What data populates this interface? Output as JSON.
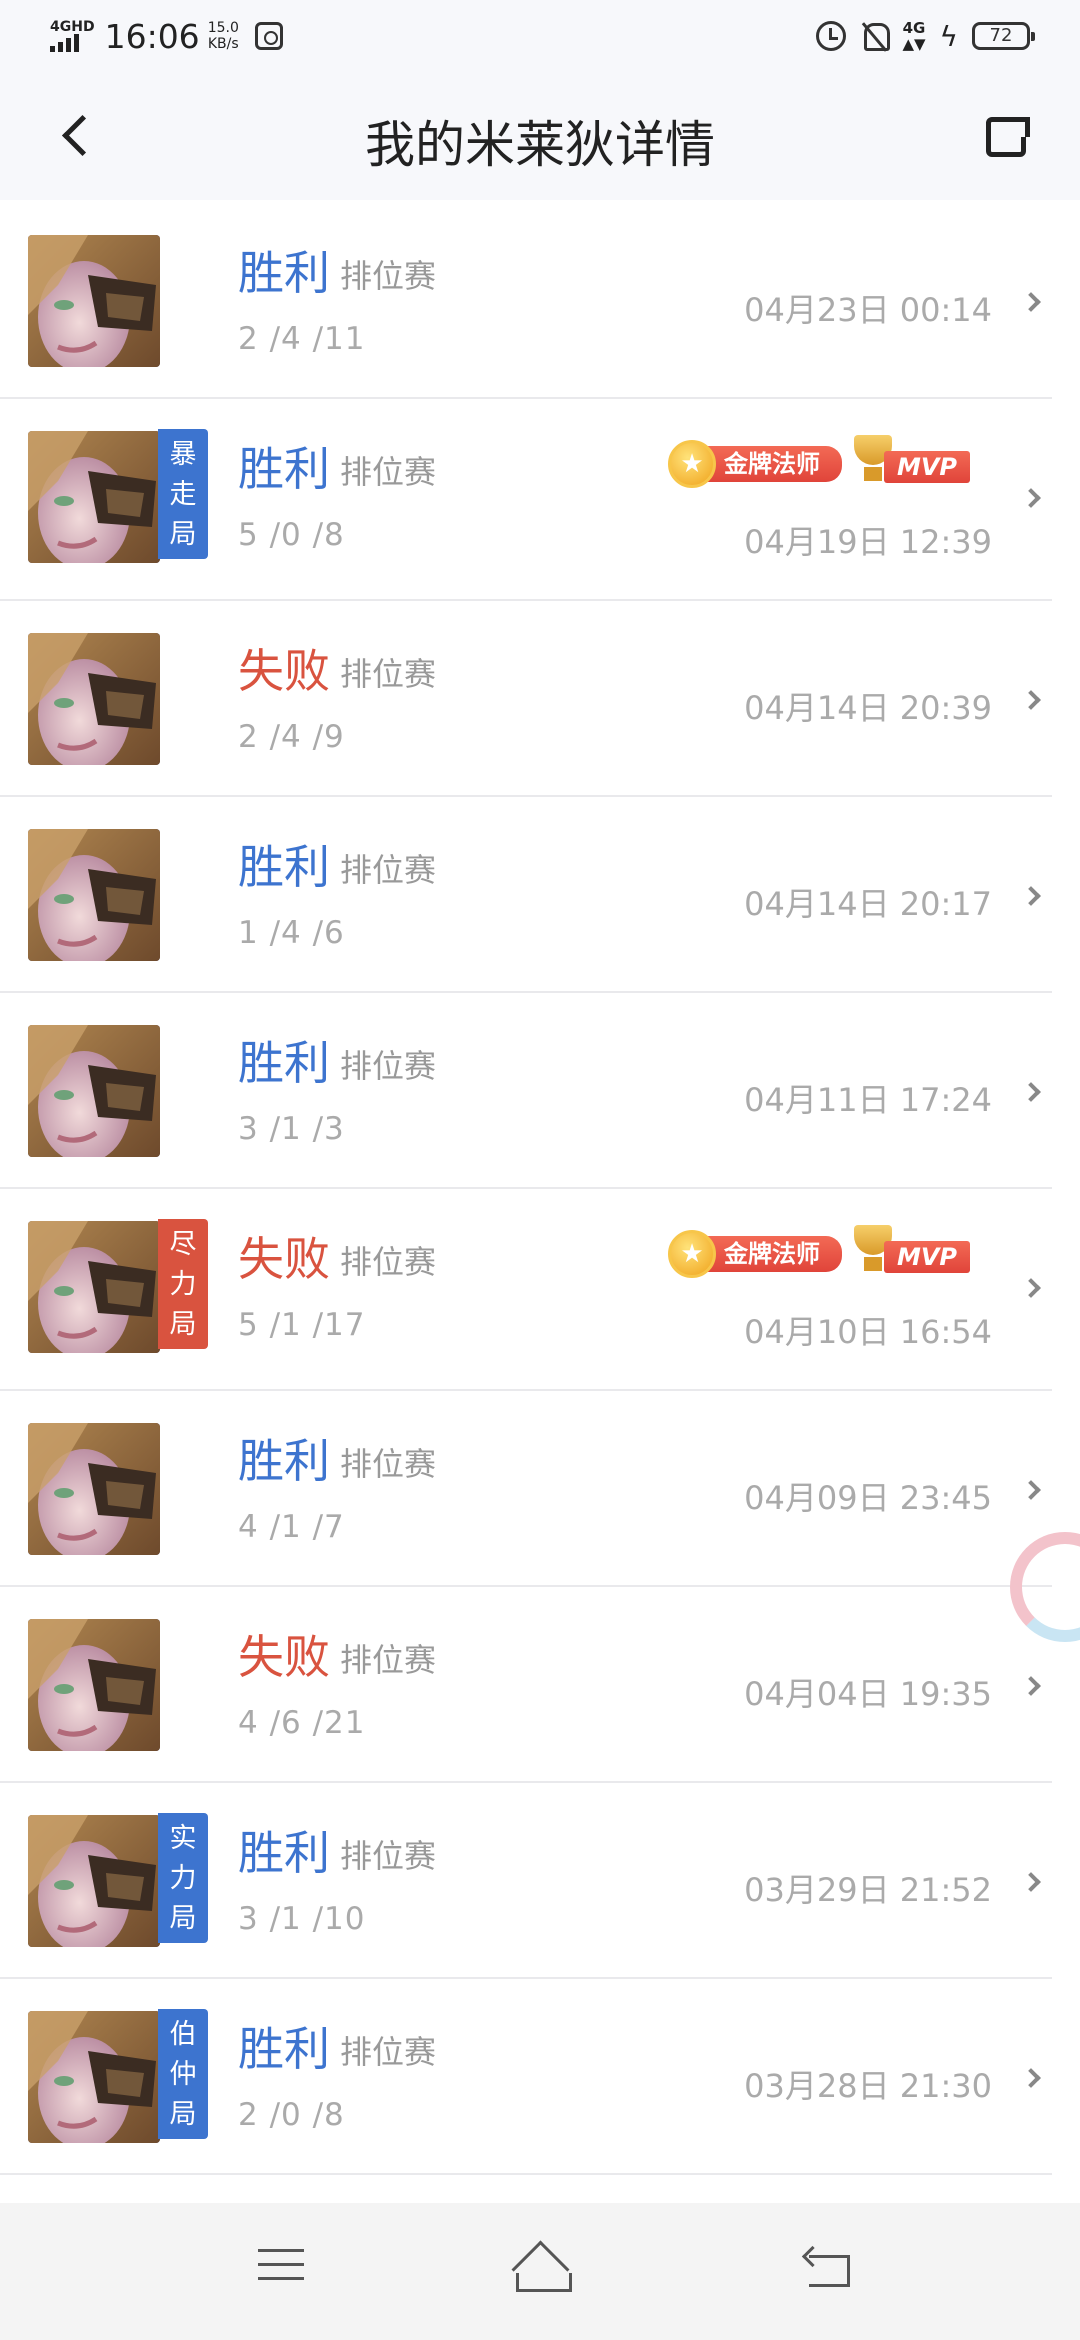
{
  "status_bar": {
    "network": "4GHD",
    "time": "16:06",
    "speed_value": "15.0",
    "speed_unit": "KB/s",
    "net_type": "4G",
    "battery": "72"
  },
  "header": {
    "title": "我的米莱狄详情"
  },
  "matches": [
    {
      "result": "胜利",
      "outcome": "win",
      "mode": "排位赛",
      "kda": "2 /4 /11",
      "datetime": "04月23日 00:14",
      "tag": "",
      "badges": false
    },
    {
      "result": "胜利",
      "outcome": "win",
      "mode": "排位赛",
      "kda": "5 /0 /8",
      "datetime": "04月19日 12:39",
      "tag": "暴走局",
      "tag_color": "blue",
      "badges": true,
      "gold_badge": "金牌法师",
      "mvp_badge": "MVP"
    },
    {
      "result": "失败",
      "outcome": "lose",
      "mode": "排位赛",
      "kda": "2 /4 /9",
      "datetime": "04月14日 20:39",
      "tag": "",
      "badges": false
    },
    {
      "result": "胜利",
      "outcome": "win",
      "mode": "排位赛",
      "kda": "1 /4 /6",
      "datetime": "04月14日 20:17",
      "tag": "",
      "badges": false
    },
    {
      "result": "胜利",
      "outcome": "win",
      "mode": "排位赛",
      "kda": "3 /1 /3",
      "datetime": "04月11日 17:24",
      "tag": "",
      "badges": false
    },
    {
      "result": "失败",
      "outcome": "lose",
      "mode": "排位赛",
      "kda": "5 /1 /17",
      "datetime": "04月10日 16:54",
      "tag": "尽力局",
      "tag_color": "red",
      "badges": true,
      "gold_badge": "金牌法师",
      "mvp_badge": "MVP"
    },
    {
      "result": "胜利",
      "outcome": "win",
      "mode": "排位赛",
      "kda": "4 /1 /7",
      "datetime": "04月09日 23:45",
      "tag": "",
      "badges": false
    },
    {
      "result": "失败",
      "outcome": "lose",
      "mode": "排位赛",
      "kda": "4 /6 /21",
      "datetime": "04月04日 19:35",
      "tag": "",
      "badges": false
    },
    {
      "result": "胜利",
      "outcome": "win",
      "mode": "排位赛",
      "kda": "3 /1 /10",
      "datetime": "03月29日 21:52",
      "tag": "实力局",
      "tag_color": "blue",
      "badges": false
    },
    {
      "result": "胜利",
      "outcome": "win",
      "mode": "排位赛",
      "kda": "2 /0 /8",
      "datetime": "03月28日 21:30",
      "tag": "伯仲局",
      "tag_color": "blue",
      "badges": false
    }
  ],
  "icons": {
    "back": "chevron-left-icon",
    "share": "share-icon",
    "row_arrow": "chevron-right-icon",
    "nav_menu": "menu-icon",
    "nav_home": "home-icon",
    "nav_back": "back-icon"
  },
  "colors": {
    "win": "#3d74cf",
    "lose": "#d9533f",
    "muted": "#aaaaaa"
  }
}
